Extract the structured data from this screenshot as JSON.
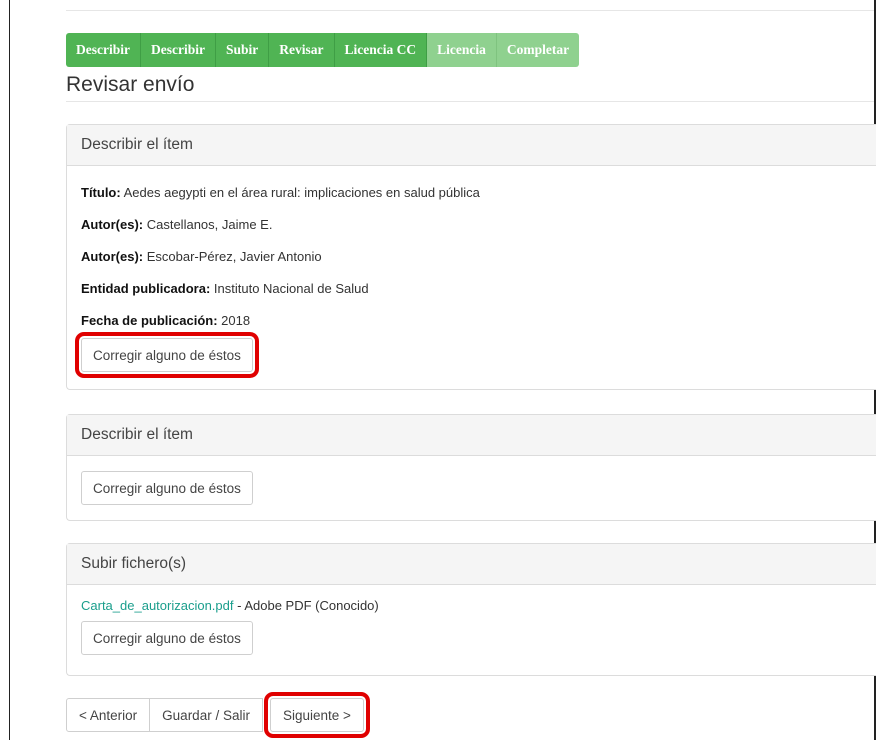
{
  "progress": {
    "steps": [
      {
        "label": "Describir",
        "state": "done"
      },
      {
        "label": "Describir",
        "state": "done"
      },
      {
        "label": "Subir",
        "state": "done"
      },
      {
        "label": "Revisar",
        "state": "done"
      },
      {
        "label": "Licencia CC",
        "state": "done"
      },
      {
        "label": "Licencia",
        "state": "pending"
      },
      {
        "label": "Completar",
        "state": "pending"
      }
    ]
  },
  "page": {
    "title": "Revisar envío"
  },
  "sections": [
    {
      "heading": "Describir el ítem",
      "fields": [
        {
          "label": "Título:",
          "value": " Aedes aegypti en el área rural: implicaciones en salud pública"
        },
        {
          "label": "Autor(es):",
          "value": " Castellanos, Jaime E."
        },
        {
          "label": "Autor(es):",
          "value": " Escobar-Pérez, Javier Antonio"
        },
        {
          "label": "Entidad publicadora:",
          "value": " Instituto Nacional de Salud"
        },
        {
          "label": "Fecha de publicación:",
          "value": " 2018"
        }
      ],
      "edit_button": "Corregir alguno de éstos"
    },
    {
      "heading": "Describir el ítem",
      "edit_button": "Corregir alguno de éstos"
    },
    {
      "heading": "Subir fichero(s)",
      "file": {
        "name": "Carta_de_autorizacion.pdf",
        "info": " - Adobe PDF (Conocido)"
      },
      "edit_button": "Corregir alguno de éstos"
    }
  ],
  "pager": {
    "previous": "< Anterior",
    "save_exit": "Guardar / Salir",
    "next": "Siguiente >"
  },
  "colors": {
    "step_done": "#50b454",
    "step_pending": "#8fd18f",
    "highlight": "#e00000",
    "link": "#1a9e8c"
  }
}
